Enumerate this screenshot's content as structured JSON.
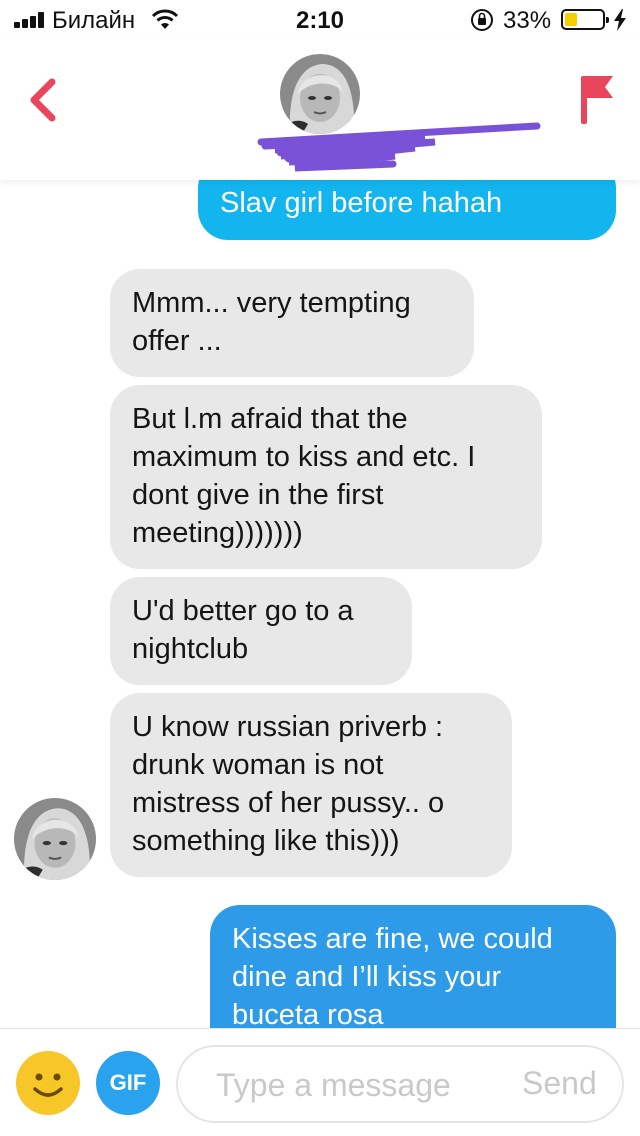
{
  "status_bar": {
    "carrier": "Билайн",
    "time": "2:10",
    "battery_percent_text": "33%",
    "battery_level": 0.33,
    "signal_bars": 4
  },
  "header": {
    "back_icon": "chevron-left-icon",
    "flag_icon": "flag-icon",
    "accent_color": "#e8465c"
  },
  "messages": [
    {
      "direction": "out",
      "lines": [
        "Slav girl before hahah"
      ]
    },
    {
      "direction": "in",
      "lines": [
        "Mmm... very tempting",
        "offer ..."
      ]
    },
    {
      "direction": "in",
      "lines": [
        "But l.m afraid that the",
        "maximum to kiss and etc. I",
        "dont give in the first",
        "meeting)))))))"
      ]
    },
    {
      "direction": "in",
      "lines": [
        "U'd better go to a",
        "nightclub"
      ]
    },
    {
      "direction": "in",
      "lines": [
        "U know russian priverb :",
        "drunk woman is not",
        "mistress of her pussy.. o",
        "something like this)))"
      ]
    },
    {
      "direction": "out",
      "lines": [
        "Kisses are fine, we could",
        "dine and I’ll kiss your",
        "buceta rosa"
      ]
    }
  ],
  "composer": {
    "emoji_icon": "smiley-icon",
    "gif_label": "GIF",
    "input_value": "",
    "input_placeholder": "Type a message",
    "send_label": "Send"
  },
  "colors": {
    "outgoing_bubble": "#12b5ee",
    "outgoing_bubble_2": "#2e9be8",
    "incoming_bubble": "#e8e8e8",
    "gif_button": "#2aa3ef",
    "emoji_button": "#f7c629",
    "redaction_scribble": "#7a52d8"
  }
}
